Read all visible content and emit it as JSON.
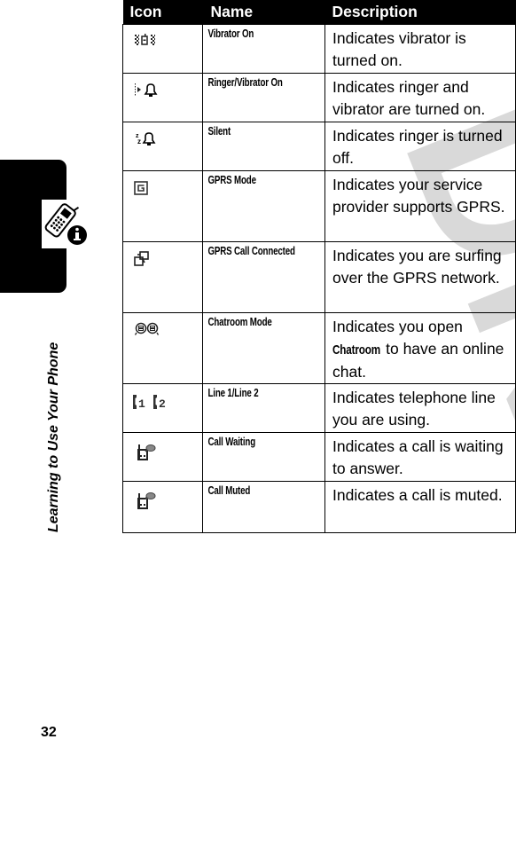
{
  "watermark": "DRAFT",
  "side_tab": {
    "icon": "phone-info-icon",
    "section_label": "Learning to Use Your Phone"
  },
  "page_number": "32",
  "table": {
    "headers": [
      "Icon",
      "Name",
      "Description"
    ],
    "rows": [
      {
        "icon": "vibrator-on-icon",
        "name": "Vibrator On",
        "description": "Indicates vibrator is turned on."
      },
      {
        "icon": "ringer-vibrator-on-icon",
        "name": "Ringer/Vibrator On",
        "description": "Indicates ringer and vibrator are turned on."
      },
      {
        "icon": "silent-icon",
        "name": "Silent",
        "description": "Indicates ringer is turned off."
      },
      {
        "icon": "gprs-mode-icon",
        "name": "GPRS Mode",
        "description": "Indicates your service provider supports GPRS."
      },
      {
        "icon": "gprs-call-connected-icon",
        "name": "GPRS Call Connected",
        "description": "Indicates you are surfing over the GPRS network."
      },
      {
        "icon": "chatroom-mode-icon",
        "name": "Chatroom Mode",
        "description_prefix": "Indicates you open",
        "description_emphasis": "Chatroom",
        "description_suffix": "to have an online chat."
      },
      {
        "icon": "line-1-line-2-icon",
        "name": "Line 1/Line 2",
        "description": "Indicates telephone line you are using."
      },
      {
        "icon": "call-waiting-icon",
        "name": "Call Waiting",
        "description": "Indicates a call is waiting to answer."
      },
      {
        "icon": "call-muted-icon",
        "name": "Call Muted",
        "description": "Indicates a call is muted."
      }
    ]
  }
}
